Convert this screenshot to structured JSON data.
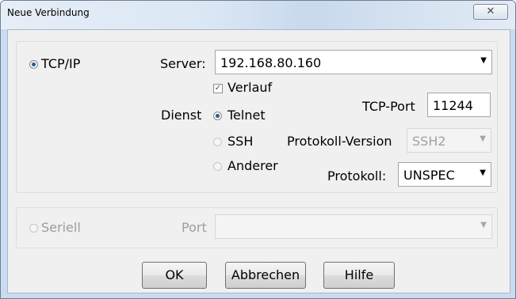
{
  "window": {
    "title": "Neue Verbindung",
    "close_glyph": "✕"
  },
  "tcpip": {
    "radio_label": "TCP/IP",
    "server_label": "Server:",
    "server_value": "192.168.80.160",
    "history_label": "Verlauf",
    "service_label": "Dienst",
    "services": [
      {
        "label": "Telnet",
        "selected": true
      },
      {
        "label": "SSH",
        "selected": false
      },
      {
        "label": "Anderer",
        "selected": false
      }
    ],
    "tcp_port_label": "TCP-Port",
    "tcp_port_value": "11244",
    "protocol_version_label": "Protokoll-Version",
    "protocol_version_value": "SSH2",
    "protocol_label": "Protokoll:",
    "protocol_value": "UNSPEC"
  },
  "serial": {
    "radio_label": "Seriell",
    "port_label": "Port",
    "port_value": ""
  },
  "buttons": {
    "ok": "OK",
    "cancel": "Abbrechen",
    "help": "Hilfe"
  },
  "icons": {
    "radio": "radio-icon",
    "checkbox": "checkbox-icon",
    "dropdown": "chevron-down-icon",
    "close": "close-icon"
  }
}
